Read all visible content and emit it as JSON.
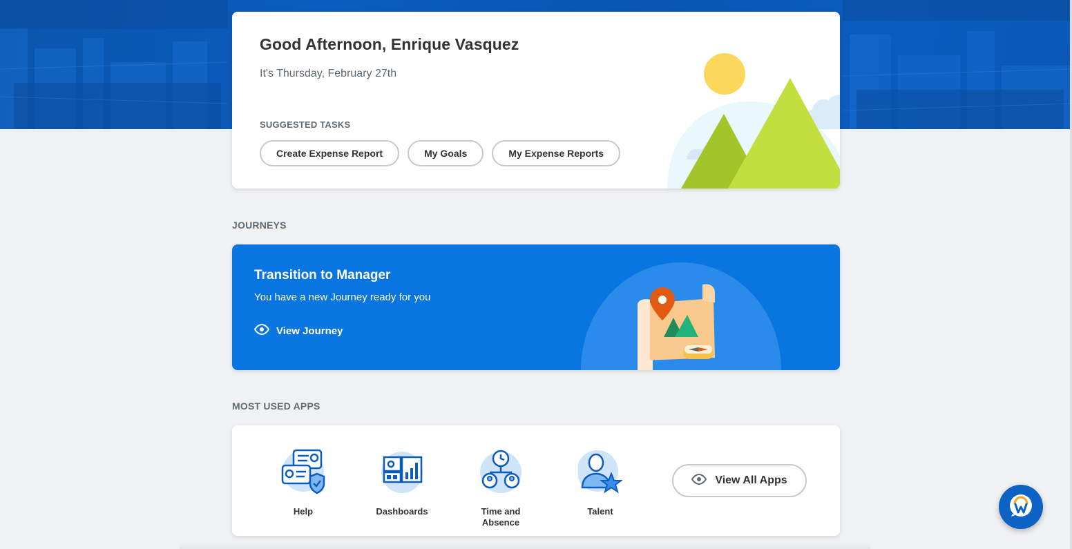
{
  "welcome": {
    "greeting": "Good Afternoon, Enrique Vasquez",
    "date_line": "It's Thursday, February 27th",
    "suggested_tasks_label": "SUGGESTED TASKS",
    "tasks": [
      {
        "label": "Create Expense Report"
      },
      {
        "label": "My Goals"
      },
      {
        "label": "My Expense Reports"
      }
    ]
  },
  "journeys": {
    "section_title": "JOURNEYS",
    "card": {
      "title": "Transition to Manager",
      "subtitle": "You have a new Journey ready for you",
      "link_label": "View Journey",
      "link_icon": "eye-icon"
    }
  },
  "apps": {
    "section_title": "MOST USED APPS",
    "items": [
      {
        "label": "Help",
        "icon": "help-icon"
      },
      {
        "label": "Dashboards",
        "icon": "dashboards-icon"
      },
      {
        "label": "Time and Absence",
        "icon": "time-absence-icon"
      },
      {
        "label": "Talent",
        "icon": "talent-icon"
      }
    ],
    "view_all_label": "View All Apps",
    "view_all_icon": "eye-icon"
  },
  "assistant": {
    "icon": "workday-assistant-icon"
  },
  "colors": {
    "brand_blue": "#0875e1",
    "hero_blue": "#0b5cbe",
    "page_bg": "#f0f1f2",
    "muted_text": "#5f6a73"
  }
}
